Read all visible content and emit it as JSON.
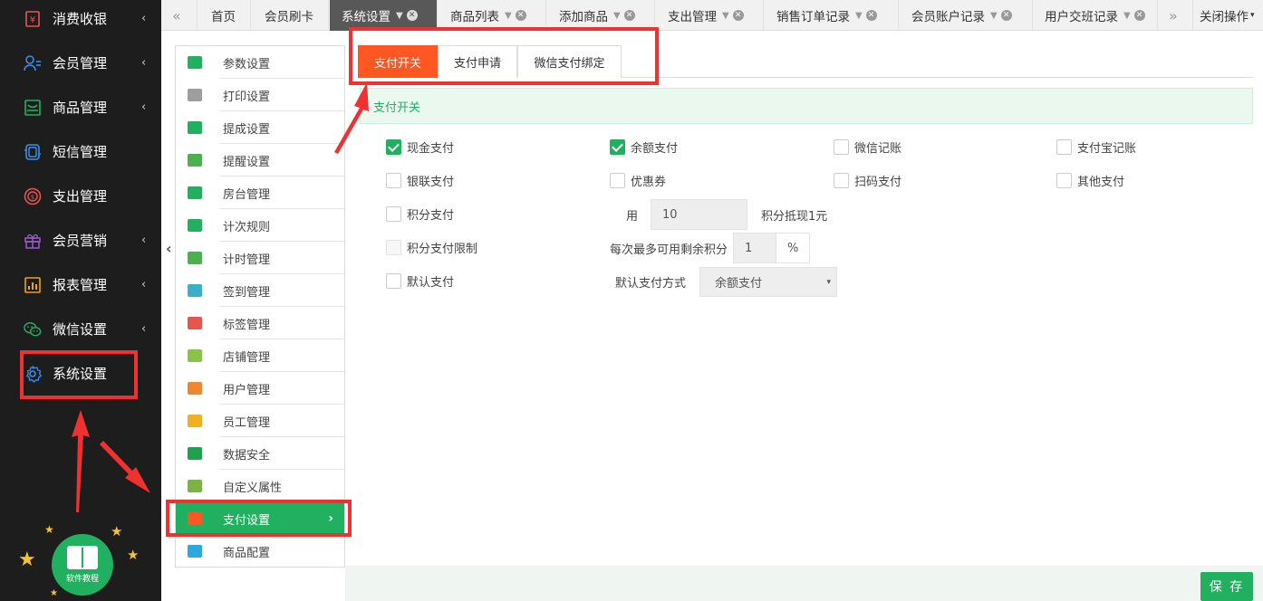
{
  "sidebar": {
    "items": [
      {
        "label": "消费收银",
        "icon": "cash-register-icon",
        "icon_color": "#e8554e",
        "has_caret": true
      },
      {
        "label": "会员管理",
        "icon": "member-icon",
        "icon_color": "#3a8fe8",
        "has_caret": true
      },
      {
        "label": "商品管理",
        "icon": "product-icon",
        "icon_color": "#21b05f",
        "has_caret": true
      },
      {
        "label": "短信管理",
        "icon": "sms-icon",
        "icon_color": "#3a8fe8",
        "has_caret": false
      },
      {
        "label": "支出管理",
        "icon": "expense-icon",
        "icon_color": "#e8554e",
        "has_caret": false
      },
      {
        "label": "会员营销",
        "icon": "gift-icon",
        "icon_color": "#9b59d0",
        "has_caret": true
      },
      {
        "label": "报表管理",
        "icon": "report-icon",
        "icon_color": "#f0a020",
        "has_caret": true
      },
      {
        "label": "微信设置",
        "icon": "wechat-icon",
        "icon_color": "#21b05f",
        "has_caret": true
      },
      {
        "label": "系统设置",
        "icon": "gear-icon",
        "icon_color": "#3a8fe8",
        "has_caret": false
      }
    ],
    "caret": "‹",
    "tutorial_label": "软件教程"
  },
  "tabs": {
    "prev": "«",
    "next": "»",
    "items": [
      {
        "label": "首页",
        "closable": false,
        "active": false
      },
      {
        "label": "会员刷卡",
        "closable": false,
        "active": false
      },
      {
        "label": "系统设置",
        "closable": true,
        "active": true
      },
      {
        "label": "商品列表",
        "closable": true,
        "active": false
      },
      {
        "label": "添加商品",
        "closable": true,
        "active": false
      },
      {
        "label": "支出管理",
        "closable": true,
        "active": false
      },
      {
        "label": "销售订单记录",
        "closable": true,
        "active": false
      },
      {
        "label": "会员账户记录",
        "closable": true,
        "active": false
      },
      {
        "label": "用户交班记录",
        "closable": true,
        "active": false
      }
    ],
    "close_ops": "关闭操作",
    "close_ops_caret": "▾"
  },
  "settings_menu": {
    "items": [
      {
        "label": "参数设置",
        "icon": "sliders-icon",
        "color": "#21b05f"
      },
      {
        "label": "打印设置",
        "icon": "printer-icon",
        "color": "#9e9e9e"
      },
      {
        "label": "提成设置",
        "icon": "commission-icon",
        "color": "#21b05f"
      },
      {
        "label": "提醒设置",
        "icon": "bell-icon",
        "color": "#4caf50"
      },
      {
        "label": "房台管理",
        "icon": "room-icon",
        "color": "#21b05f"
      },
      {
        "label": "计次规则",
        "icon": "rules-icon",
        "color": "#21b05f"
      },
      {
        "label": "计时管理",
        "icon": "clock-icon",
        "color": "#4caf50"
      },
      {
        "label": "签到管理",
        "icon": "checkin-icon",
        "color": "#3ab0c8"
      },
      {
        "label": "标签管理",
        "icon": "tag-icon",
        "color": "#e8554e"
      },
      {
        "label": "店铺管理",
        "icon": "store-icon",
        "color": "#8bc34a"
      },
      {
        "label": "用户管理",
        "icon": "user-icon",
        "color": "#f0872f"
      },
      {
        "label": "员工管理",
        "icon": "staff-icon",
        "color": "#f0b020"
      },
      {
        "label": "数据安全",
        "icon": "chart-icon",
        "color": "#21a04f"
      },
      {
        "label": "自定义属性",
        "icon": "pen-icon",
        "color": "#7cb342"
      },
      {
        "label": "支付设置",
        "icon": "payment-icon",
        "color": "#ff5722",
        "active": true
      },
      {
        "label": "商品配置",
        "icon": "tools-icon",
        "color": "#29a9e0"
      }
    ],
    "active_chevron": "›",
    "collapse_arrow": "‹"
  },
  "content": {
    "subtabs": [
      {
        "label": "支付开关",
        "active": true
      },
      {
        "label": "支付申请",
        "active": false
      },
      {
        "label": "微信支付绑定",
        "active": false
      }
    ],
    "section_title": "支付开关",
    "payment_options": [
      {
        "label": "现金支付",
        "checked": true
      },
      {
        "label": "余额支付",
        "checked": true
      },
      {
        "label": "微信记账",
        "checked": false
      },
      {
        "label": "支付宝记账",
        "checked": false
      },
      {
        "label": "银联支付",
        "checked": false
      },
      {
        "label": "优惠券",
        "checked": false
      },
      {
        "label": "扫码支付",
        "checked": false
      },
      {
        "label": "其他支付",
        "checked": false
      }
    ],
    "points_pay": {
      "label": "积分支付",
      "checked": false,
      "prefix": "用",
      "value": "10",
      "suffix": "积分抵现1元"
    },
    "points_limit": {
      "label": "积分支付限制",
      "checked": false,
      "prefix": "每次最多可用剩余积分",
      "value": "1",
      "unit": "%"
    },
    "default_pay": {
      "label": "默认支付",
      "checked": false,
      "prefix": "默认支付方式",
      "selected": "余额支付",
      "caret": "▾"
    },
    "save_label": "保 存"
  },
  "colors": {
    "sidebar_bg": "#1d1d1d",
    "accent_green": "#21b05f",
    "accent_orange": "#ff5722",
    "annotation_red": "#f03131"
  }
}
